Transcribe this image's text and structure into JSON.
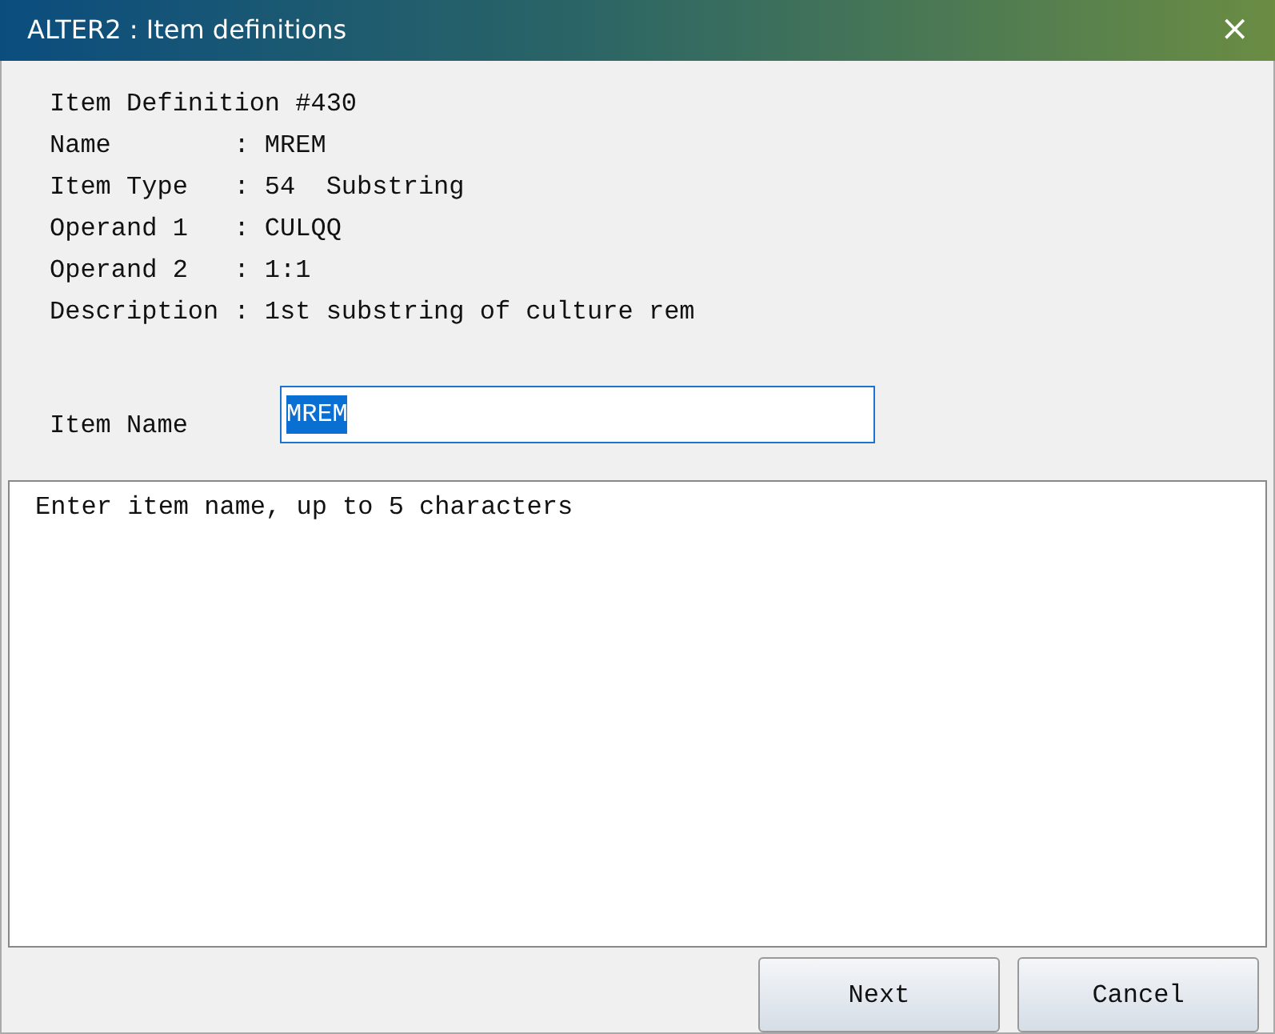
{
  "window": {
    "title": "ALTER2 : Item definitions",
    "close": "×"
  },
  "definition_lines": [
    "Item Definition #430",
    "Name        : MREM",
    "Item Type   : 54  Substring",
    "Operand 1   : CULQQ",
    "Operand 2   : 1:1",
    "Description : 1st substring of culture rem"
  ],
  "item_name": {
    "label": "Item Name",
    "value": "MREM",
    "text_selected": true
  },
  "message": "Enter item name, up to 5 characters",
  "buttons": [
    "Next",
    "Cancel"
  ]
}
